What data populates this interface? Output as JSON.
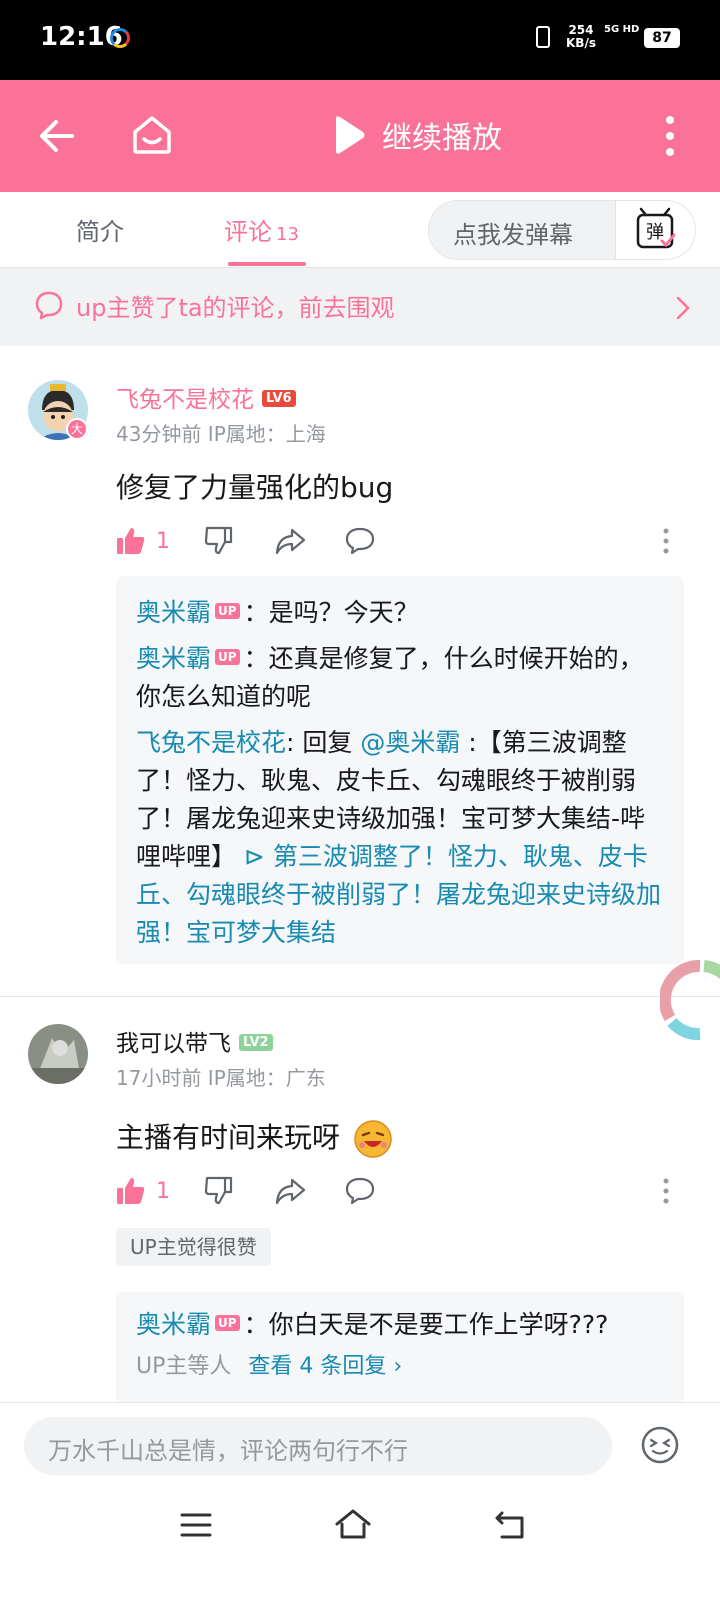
{
  "status_bar": {
    "time": "12:16",
    "speed_value": "254",
    "speed_unit": "KB/s",
    "network": "5G HD",
    "battery": "87"
  },
  "top_bar": {
    "play_label": "继续播放",
    "accent_color": "#fb7299"
  },
  "tabs": {
    "intro": "简介",
    "comments": "评论",
    "comments_count": "13",
    "danmaku_placeholder": "点我发弹幕",
    "danmaku_icon_text": "弹"
  },
  "notice": {
    "text": "up主赞了ta的评论，前去围观"
  },
  "comments": [
    {
      "username": "飞兔不是校花",
      "level": "LV6",
      "meta": "43分钟前 IP属地：上海",
      "content": "修复了力量强化的bug",
      "likes": "1",
      "avatar_badge": "大",
      "replies": [
        {
          "name": "奥米霸",
          "tag": "UP",
          "text": "：是吗？今天？"
        },
        {
          "name": "奥米霸",
          "tag": "UP",
          "text": "：还真是修复了，什么时候开始的，你怎么知道的呢"
        },
        {
          "name": "飞兔不是校花",
          "prefix": ": 回复 ",
          "mention": "@奥米霸",
          "body": " :【第三波调整了！怪力、耿鬼、皮卡丘、勾魂眼终于被削弱了！屠龙兔迎来史诗级加强！宝可梦大集结-哔哩哔哩】",
          "link": "第三波调整了！怪力、耿鬼、皮卡丘、勾魂眼终于被削弱了！屠龙兔迎来史诗级加强！宝可梦大集结"
        }
      ]
    },
    {
      "username": "我可以带飞",
      "level": "LV2",
      "meta": "17小时前 IP属地：广东",
      "content": "主播有时间来玩呀",
      "likes": "1",
      "up_badge": "UP主觉得很赞",
      "replies": [
        {
          "name": "奥米霸",
          "tag": "UP",
          "text": "：你白天是不是要工作上学呀???"
        }
      ],
      "reply_summary_prefix": "UP主等人",
      "reply_summary_link": "查看 4 条回复 ›"
    }
  ],
  "input": {
    "placeholder": "万水千山总是情，评论两句行不行"
  }
}
